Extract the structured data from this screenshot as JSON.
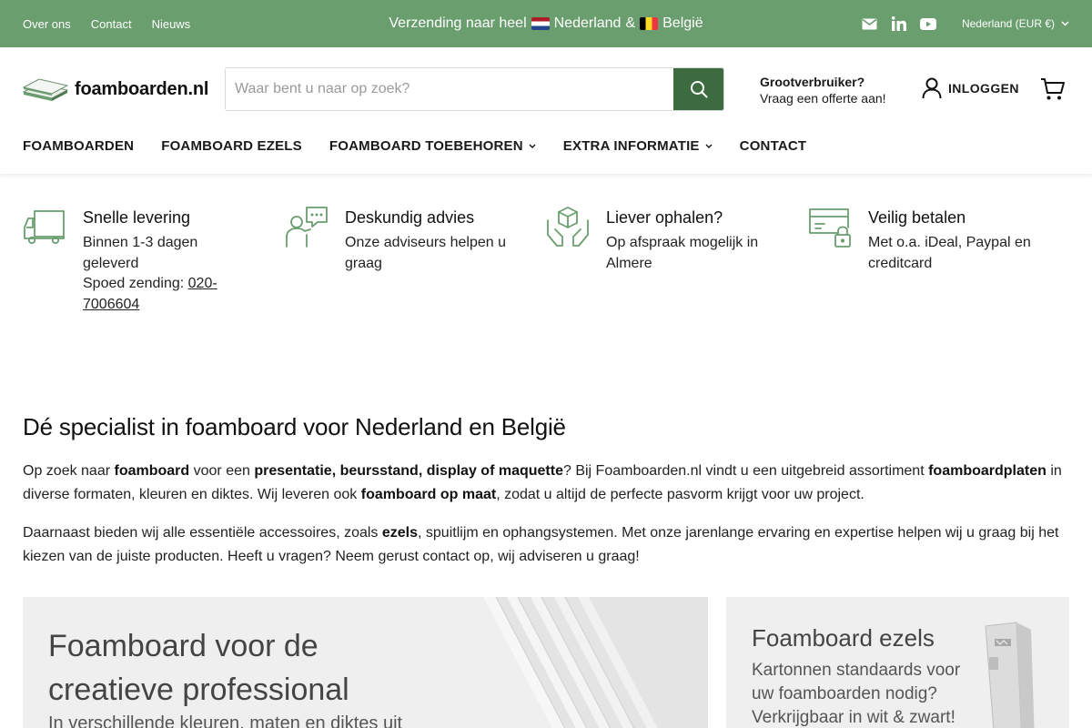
{
  "topbar": {
    "links": [
      "Over ons",
      "Contact",
      "Nieuws"
    ],
    "announcement": {
      "prefix": "Verzending naar heel",
      "country1": "Nederland",
      "separator": "&",
      "country2": "België"
    },
    "country_selector": "Nederland (EUR €)",
    "colors": {
      "background": "#6a9e6f"
    }
  },
  "header": {
    "logo_text": "foamboarden.nl",
    "search": {
      "placeholder": "Waar bent u naar op zoek?"
    },
    "bulk_buyer": {
      "line1": "Grootverbruiker?",
      "line2": "Vraag een offerte aan!"
    },
    "login_label": "INLOGGEN",
    "nav": [
      {
        "label": "FOAMBOARDEN",
        "dropdown": false
      },
      {
        "label": "FOAMBOARD EZELS",
        "dropdown": false
      },
      {
        "label": "FOAMBOARD TOEBEHOREN",
        "dropdown": true
      },
      {
        "label": "EXTRA INFORMATIE",
        "dropdown": true
      },
      {
        "label": "CONTACT",
        "dropdown": false
      }
    ],
    "accent_color": "#3d6b40"
  },
  "usps": [
    {
      "icon": "truck-icon",
      "title": "Snelle levering",
      "line1": "Binnen 1-3 dagen geleverd",
      "line2_prefix": "Spoed zending: ",
      "line2_link": "020-7006604"
    },
    {
      "icon": "advisor-chat-icon",
      "title": "Deskundig advies",
      "text": "Onze adviseurs helpen u graag"
    },
    {
      "icon": "hands-box-icon",
      "title": "Liever ophalen?",
      "text": "Op afspraak mogelijk in Almere"
    },
    {
      "icon": "card-lock-icon",
      "title": "Veilig betalen",
      "text": "Met o.a. iDeal, Paypal en creditcard"
    }
  ],
  "intro": {
    "heading": "Dé specialist in foamboard voor Nederland en België",
    "p1": {
      "t1": "Op zoek naar ",
      "b1": "foamboard",
      "t2": " voor een ",
      "b2": "presentatie, beursstand, display of maquette",
      "t3": "? Bij ",
      "link": "Foamboarden.nl",
      "t4": " vindt u een uitgebreid assortiment ",
      "b3": "foamboardplaten",
      "t5": " in diverse formaten, kleuren en diktes. Wij leveren ook ",
      "b4": "foamboard op maat",
      "t6": ", zodat u altijd de perfecte pasvorm krijgt voor uw project."
    },
    "p2": {
      "t1": "Daarnaast bieden wij alle essentiële accessoires, zoals ",
      "b1": "ezels",
      "t2": ", spuitlijm en ophangsystemen. Met onze jarenlange ervaring en expertise helpen wij u graag bij het kiezen van de juiste producten. Heeft u vragen? Neem gerust contact op, wij adviseren u graag!"
    }
  },
  "tiles": [
    {
      "title": "Foamboard voor de creatieve professional",
      "subtitle": "In verschillende kleuren, maten en diktes uit"
    },
    {
      "title": "Foamboard ezels",
      "text": "Kartonnen standaards voor uw foamboarden nodig? Verkrijgbaar in wit & zwart!"
    }
  ]
}
